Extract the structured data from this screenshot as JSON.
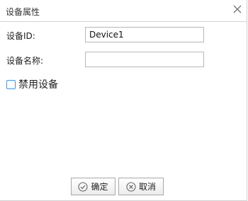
{
  "dialog": {
    "title": "设备属性",
    "close_icon": "close-icon"
  },
  "form": {
    "device_id_label": "设备ID:",
    "device_id_value": "Device1",
    "device_name_label": "设备名称:",
    "device_name_value": "",
    "disable_label": "禁用设备",
    "disable_checked": false
  },
  "buttons": {
    "ok_label": "确定",
    "ok_icon": "check-circle-icon",
    "cancel_label": "取消",
    "cancel_icon": "x-circle-icon"
  },
  "colors": {
    "checkbox_border": "#4a90d9"
  }
}
